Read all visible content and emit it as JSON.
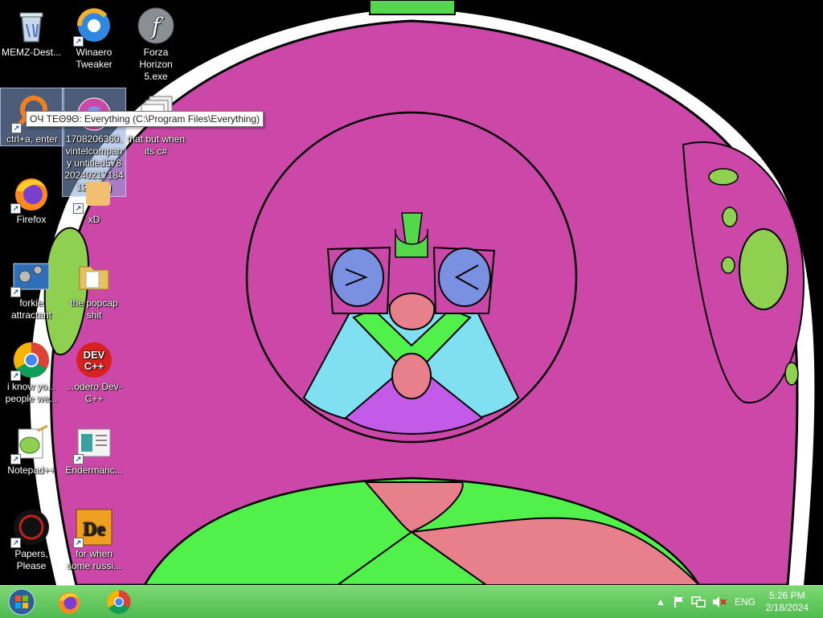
{
  "desktop": {
    "icons": [
      {
        "label": "MEMZ-Dest...",
        "icon": "recycle-bin-icon",
        "shortcut": false
      },
      {
        "label": "Winaero Tweaker",
        "icon": "winaero-icon",
        "shortcut": true
      },
      {
        "label": "Forza Horizon 5.exe",
        "icon": "flash-icon",
        "shortcut": false
      },
      {
        "label": "ctrl+a, enter",
        "icon": "everything-search-icon",
        "shortcut": true
      },
      {
        "label": "1708206360.vintelcompany untitled578 20240217184129.png",
        "icon": "image-file-icon",
        "shortcut": false
      },
      {
        "label": "that but when its c#",
        "icon": "window-stack-icon",
        "shortcut": false
      },
      {
        "label": "Firefox",
        "icon": "firefox-icon",
        "shortcut": true
      },
      {
        "label": "xD",
        "icon": "xd-icon",
        "shortcut": true
      },
      {
        "label": "forkie attractant",
        "icon": "gear-window-icon",
        "shortcut": true
      },
      {
        "label": "the popcap shit",
        "icon": "folder-icon",
        "shortcut": false
      },
      {
        "label": "i know yo... people we...",
        "icon": "chrome-icon",
        "shortcut": true
      },
      {
        "label": "...odero Dev-C++",
        "icon": "devcpp-icon",
        "shortcut": false
      },
      {
        "label": "Notepad++",
        "icon": "notepadpp-icon",
        "shortcut": true
      },
      {
        "label": "Endermanc...",
        "icon": "document-window-icon",
        "shortcut": true
      },
      {
        "label": "Papers, Please",
        "icon": "papers-please-icon",
        "shortcut": true
      },
      {
        "label": "for when some russi...",
        "icon": "de-icon",
        "shortcut": true
      }
    ],
    "tooltip": "O⁠Ч TEΘ9Θ: Everything (C:\\Program Files\\Everything)",
    "devcpp_text": "DEV C++"
  },
  "taskbar": {
    "start": "start-orb-icon",
    "pinned": [
      "firefox-icon",
      "chrome-icon"
    ],
    "tray": {
      "chevron": "show-hidden-icons-chevron",
      "flag": "action-center-flag-icon",
      "network": "network-icon",
      "volume": "volume-muted-icon",
      "language": "ENG"
    },
    "time": "5:26 PM",
    "date": "2/18/2024"
  },
  "colors": {
    "taskbar": "#57c255",
    "wallpaper_magenta": "#cc48a8",
    "wallpaper_green": "#52f04a",
    "wallpaper_pink": "#e8808c",
    "wallpaper_cyan": "#7ee0f0"
  }
}
